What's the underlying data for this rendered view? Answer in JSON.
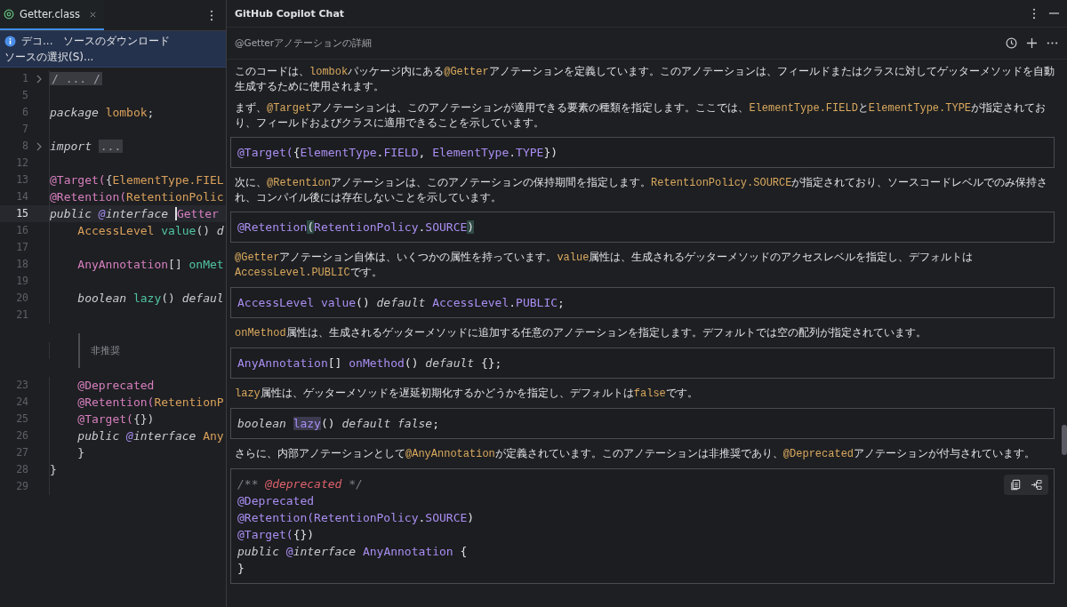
{
  "editor": {
    "tabs": [
      {
        "label": "Getter.class",
        "selected": true
      }
    ],
    "notice": {
      "items": [
        "デコ...",
        "ソースのダウンロード",
        "ソースの選択(S)..."
      ]
    },
    "lines": [
      {
        "kind": "code",
        "number": "1",
        "folded": true,
        "current": false,
        "tokens": [
          {
            "kind": "fold",
            "text": "/ ... /"
          }
        ]
      },
      {
        "kind": "code",
        "number": "5",
        "folded": false,
        "current": false
      },
      {
        "kind": "code",
        "number": "6",
        "folded": false,
        "current": false,
        "tokens": [
          {
            "kind": "keyword",
            "text": "package "
          },
          {
            "kind": "type",
            "text": "lombok"
          },
          {
            "kind": "punct",
            "text": ";"
          }
        ]
      },
      {
        "kind": "code",
        "number": "7",
        "folded": false,
        "current": false
      },
      {
        "kind": "code",
        "number": "8",
        "folded": true,
        "current": false,
        "tokens": [
          {
            "kind": "keyword",
            "text": "import "
          },
          {
            "kind": "fold",
            "text": "..."
          }
        ]
      },
      {
        "kind": "code",
        "number": "12",
        "folded": false,
        "current": false
      },
      {
        "kind": "code",
        "number": "13",
        "folded": false,
        "current": false,
        "tokens": [
          {
            "kind": "annotation",
            "text": "@Target("
          },
          {
            "kind": "punct",
            "text": "{"
          },
          {
            "kind": "type",
            "text": "ElementType.FIEL"
          }
        ]
      },
      {
        "kind": "code",
        "number": "14",
        "folded": false,
        "current": false,
        "tokens": [
          {
            "kind": "annotation",
            "text": "@Retention("
          },
          {
            "kind": "type",
            "text": "RetentionPolic"
          }
        ]
      },
      {
        "kind": "code",
        "number": "15",
        "folded": false,
        "current": true,
        "tokens": [
          {
            "kind": "keyword",
            "text": "public "
          },
          {
            "kind": "at",
            "text": "@"
          },
          {
            "kind": "keyword",
            "text": "interface "
          },
          {
            "kind": "annotation_caret",
            "text": "Getter"
          }
        ]
      },
      {
        "kind": "code",
        "number": "16",
        "folded": false,
        "current": false,
        "tokens": [
          {
            "kind": "type",
            "text": "    AccessLevel "
          },
          {
            "kind": "method",
            "text": "value"
          },
          {
            "kind": "punct",
            "text": "() "
          },
          {
            "kind": "keyword",
            "text": "d"
          }
        ]
      },
      {
        "kind": "code",
        "number": "17",
        "folded": false,
        "current": false
      },
      {
        "kind": "code",
        "number": "18",
        "folded": false,
        "current": false,
        "tokens": [
          {
            "kind": "annotation",
            "text": "    AnyAnnotation"
          },
          {
            "kind": "punct",
            "text": "[] "
          },
          {
            "kind": "method",
            "text": "onMet"
          }
        ]
      },
      {
        "kind": "code",
        "number": "19",
        "folded": false,
        "current": false
      },
      {
        "kind": "code",
        "number": "20",
        "folded": false,
        "current": false,
        "tokens": [
          {
            "kind": "keyword",
            "text": "    boolean "
          },
          {
            "kind": "method",
            "text": "lazy"
          },
          {
            "kind": "punct",
            "text": "() "
          },
          {
            "kind": "keyword",
            "text": "defaul"
          }
        ]
      },
      {
        "kind": "code",
        "number": "21",
        "folded": false,
        "current": false
      },
      {
        "kind": "doc",
        "text": "非推奨"
      },
      {
        "kind": "code",
        "number": "23",
        "folded": false,
        "current": false,
        "tokens": [
          {
            "kind": "annotation",
            "text": "    @Deprecated"
          }
        ]
      },
      {
        "kind": "code",
        "number": "24",
        "folded": false,
        "current": false,
        "tokens": [
          {
            "kind": "annotation",
            "text": "    @Retention("
          },
          {
            "kind": "type",
            "text": "RetentionP"
          }
        ]
      },
      {
        "kind": "code",
        "number": "25",
        "folded": false,
        "current": false,
        "tokens": [
          {
            "kind": "annotation",
            "text": "    @Target("
          },
          {
            "kind": "punct",
            "text": "{})"
          }
        ]
      },
      {
        "kind": "code",
        "number": "26",
        "folded": false,
        "current": false,
        "tokens": [
          {
            "kind": "keyword",
            "text": "    public "
          },
          {
            "kind": "at",
            "text": "@"
          },
          {
            "kind": "keyword",
            "text": "interface "
          },
          {
            "kind": "type",
            "text": "Any"
          }
        ]
      },
      {
        "kind": "code",
        "number": "27",
        "folded": false,
        "current": false,
        "tokens": [
          {
            "kind": "punct",
            "text": "    }"
          }
        ]
      },
      {
        "kind": "code",
        "number": "28",
        "folded": false,
        "current": false,
        "tokens": [
          {
            "kind": "punct",
            "text": "}"
          }
        ]
      },
      {
        "kind": "code",
        "number": "29",
        "folded": false,
        "current": false
      }
    ]
  },
  "chat": {
    "title": "GitHub Copilot Chat",
    "topic": "@Getterアノテーションの詳細",
    "blocks": [
      {
        "kind": "paragraph",
        "segments": [
          {
            "text": "このコードは、",
            "code": false
          },
          {
            "text": "lombok",
            "code": true
          },
          {
            "text": "パッケージ内にある",
            "code": false
          },
          {
            "text": "@Getter",
            "code": true
          },
          {
            "text": "アノテーションを定義しています。このアノテーションは、フィールドまたはクラスに対してゲッターメソッドを自動生成するために使用されます。",
            "code": false
          }
        ]
      },
      {
        "kind": "paragraph",
        "segments": [
          {
            "text": "まず、",
            "code": false
          },
          {
            "text": "@Target",
            "code": true
          },
          {
            "text": "アノテーションは、このアノテーションが適用できる要素の種類を指定します。ここでは、",
            "code": false
          },
          {
            "text": "ElementType.FIELD",
            "code": true
          },
          {
            "text": "と",
            "code": false
          },
          {
            "text": "ElementType.TYPE",
            "code": true
          },
          {
            "text": "が指定されており、フィールドおよびクラスに適用できることを示しています。",
            "code": false
          }
        ]
      },
      {
        "kind": "code",
        "hovered": false,
        "lines": [
          [
            {
              "kind": "name",
              "text": "@Target("
            },
            {
              "kind": "punct",
              "text": "{"
            },
            {
              "kind": "name",
              "text": "ElementType"
            },
            {
              "kind": "punct",
              "text": "."
            },
            {
              "kind": "name",
              "text": "FIELD"
            },
            {
              "kind": "punct",
              "text": ", "
            },
            {
              "kind": "name",
              "text": "ElementType"
            },
            {
              "kind": "punct",
              "text": "."
            },
            {
              "kind": "name",
              "text": "TYPE"
            },
            {
              "kind": "punct",
              "text": "})"
            }
          ]
        ]
      },
      {
        "kind": "paragraph",
        "segments": [
          {
            "text": "次に、",
            "code": false
          },
          {
            "text": "@Retention",
            "code": true
          },
          {
            "text": "アノテーションは、このアノテーションの保持期間を指定します。",
            "code": false
          },
          {
            "text": "RetentionPolicy.SOURCE",
            "code": true
          },
          {
            "text": "が指定されており、ソースコードレベルでのみ保持され、コンパイル後には存在しないことを示しています。",
            "code": false
          }
        ]
      },
      {
        "kind": "code",
        "hovered": false,
        "lines": [
          [
            {
              "kind": "name",
              "text": "@Retention"
            },
            {
              "kind": "punct_match",
              "text": "("
            },
            {
              "kind": "name",
              "text": "RetentionPolicy"
            },
            {
              "kind": "punct",
              "text": "."
            },
            {
              "kind": "name",
              "text": "SOURCE"
            },
            {
              "kind": "punct_match",
              "text": ")"
            }
          ]
        ]
      },
      {
        "kind": "paragraph",
        "segments": [
          {
            "text": "@Getter",
            "code": true
          },
          {
            "text": "アノテーション自体は、いくつかの属性を持っています。",
            "code": false
          },
          {
            "text": "value",
            "code": true
          },
          {
            "text": "属性は、生成されるゲッターメソッドのアクセスレベルを指定し、デフォルトは",
            "code": false
          },
          {
            "text": "AccessLevel.PUBLIC",
            "code": true
          },
          {
            "text": "です。",
            "code": false
          }
        ]
      },
      {
        "kind": "code",
        "hovered": false,
        "lines": [
          [
            {
              "kind": "name",
              "text": "AccessLevel value"
            },
            {
              "kind": "punct",
              "text": "() "
            },
            {
              "kind": "keyword",
              "text": "default "
            },
            {
              "kind": "name",
              "text": "AccessLevel"
            },
            {
              "kind": "punct",
              "text": "."
            },
            {
              "kind": "name",
              "text": "PUBLIC"
            },
            {
              "kind": "punct",
              "text": ";"
            }
          ]
        ]
      },
      {
        "kind": "paragraph",
        "segments": [
          {
            "text": "onMethod",
            "code": true
          },
          {
            "text": "属性は、生成されるゲッターメソッドに追加する任意のアノテーションを指定します。デフォルトでは空の配列が指定されています。",
            "code": false
          }
        ]
      },
      {
        "kind": "code",
        "hovered": false,
        "lines": [
          [
            {
              "kind": "name",
              "text": "AnyAnnotation"
            },
            {
              "kind": "punct",
              "text": "[] "
            },
            {
              "kind": "name",
              "text": "onMethod"
            },
            {
              "kind": "punct",
              "text": "() "
            },
            {
              "kind": "keyword",
              "text": "default"
            },
            {
              "kind": "punct",
              "text": " {};"
            }
          ]
        ]
      },
      {
        "kind": "paragraph",
        "segments": [
          {
            "text": "lazy",
            "code": true
          },
          {
            "text": "属性は、ゲッターメソッドを遅延初期化するかどうかを指定し、デフォルトは",
            "code": false
          },
          {
            "text": "false",
            "code": true
          },
          {
            "text": "です。",
            "code": false
          }
        ]
      },
      {
        "kind": "code",
        "hovered": false,
        "lines": [
          [
            {
              "kind": "keyword",
              "text": "boolean "
            },
            {
              "kind": "name_match",
              "text": "lazy"
            },
            {
              "kind": "punct",
              "text": "() "
            },
            {
              "kind": "keyword",
              "text": "default false"
            },
            {
              "kind": "punct",
              "text": ";"
            }
          ]
        ]
      },
      {
        "kind": "paragraph",
        "segments": [
          {
            "text": "さらに、内部アノテーションとして",
            "code": false
          },
          {
            "text": "@AnyAnnotation",
            "code": true
          },
          {
            "text": "が定義されています。このアノテーションは非推奨であり、",
            "code": false
          },
          {
            "text": "@Deprecated",
            "code": true
          },
          {
            "text": "アノテーションが付与されています。",
            "code": false
          }
        ]
      },
      {
        "kind": "code",
        "hovered": true,
        "lines": [
          [
            {
              "kind": "comment",
              "text": "/** "
            },
            {
              "kind": "doctag",
              "text": "@deprecated"
            },
            {
              "kind": "comment",
              "text": " */"
            }
          ],
          [
            {
              "kind": "name",
              "text": "@Deprecated"
            }
          ],
          [
            {
              "kind": "name",
              "text": "@Retention("
            },
            {
              "kind": "name",
              "text": "RetentionPolicy"
            },
            {
              "kind": "punct",
              "text": "."
            },
            {
              "kind": "name",
              "text": "SOURCE"
            },
            {
              "kind": "punct",
              "text": ")"
            }
          ],
          [
            {
              "kind": "name",
              "text": "@Target("
            },
            {
              "kind": "punct",
              "text": "{})"
            }
          ],
          [
            {
              "kind": "keyword",
              "text": "public "
            },
            {
              "kind": "name",
              "text": "@"
            },
            {
              "kind": "keyword",
              "text": "interface "
            },
            {
              "kind": "name",
              "text": "AnyAnnotation"
            },
            {
              "kind": "punct",
              "text": " {"
            }
          ],
          [
            {
              "kind": "punct",
              "text": "}"
            }
          ]
        ]
      }
    ]
  }
}
